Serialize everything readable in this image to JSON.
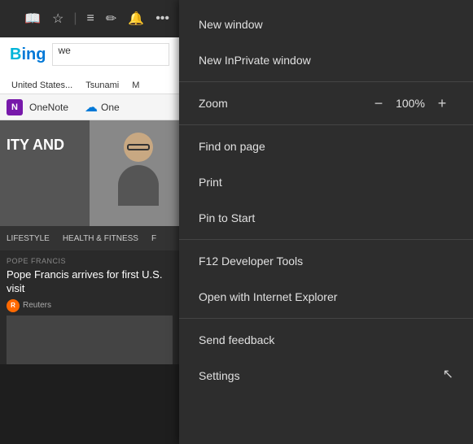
{
  "browser": {
    "toolbar": {
      "icons": [
        "book-icon",
        "star-icon",
        "list-icon",
        "annotation-icon",
        "bell-icon",
        "more-icon"
      ]
    },
    "page": {
      "bing_logo": "Bing",
      "search_placeholder": "we",
      "tabs": [
        "United States...",
        "Tsunami",
        "M"
      ],
      "onenote_label": "OneNote",
      "one_label": "One",
      "hero_text": "ITY AND",
      "person_label": "Pope Francis",
      "card_label": "POPE FRANCIS",
      "card_title": "Pope Francis arrives for first U.S. visit",
      "card_source": "Reuters",
      "sub_nav_items": [
        "LIFESTYLE",
        "HEALTH & FITNESS",
        "F"
      ]
    }
  },
  "menu": {
    "items": [
      {
        "id": "new-window",
        "label": "New window"
      },
      {
        "id": "new-inprivate-window",
        "label": "New InPrivate window"
      },
      {
        "id": "zoom",
        "label": "Zoom",
        "value": "100%",
        "type": "zoom"
      },
      {
        "id": "find-on-page",
        "label": "Find on page"
      },
      {
        "id": "print",
        "label": "Print"
      },
      {
        "id": "pin-to-start",
        "label": "Pin to Start"
      },
      {
        "id": "f12-developer-tools",
        "label": "F12 Developer Tools"
      },
      {
        "id": "open-with-ie",
        "label": "Open with Internet Explorer"
      },
      {
        "id": "send-feedback",
        "label": "Send feedback"
      },
      {
        "id": "settings",
        "label": "Settings"
      }
    ],
    "zoom_minus": "−",
    "zoom_plus": "+"
  }
}
